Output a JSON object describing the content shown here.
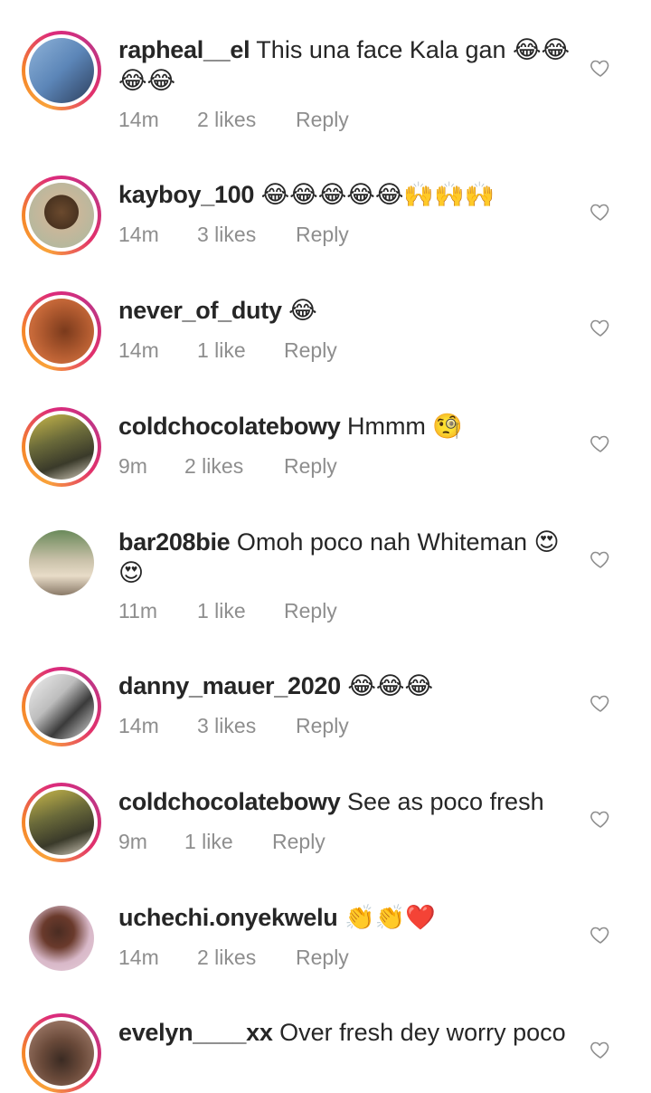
{
  "comments": [
    {
      "username": "rapheal__el",
      "text": " This una face Kala gan 😂😂😂😂",
      "time": "14m",
      "likes": "2 likes",
      "reply": "Reply"
    },
    {
      "username": "kayboy_100",
      "text": " 😂😂😂😂😂🙌🙌🙌",
      "time": "14m",
      "likes": "3 likes",
      "reply": "Reply"
    },
    {
      "username": "never_of_duty",
      "text": " 😂",
      "time": "14m",
      "likes": "1 like",
      "reply": "Reply"
    },
    {
      "username": "coldchocolatebowy",
      "text": " Hmmm 🧐",
      "time": "9m",
      "likes": "2 likes",
      "reply": "Reply"
    },
    {
      "username": "bar208bie",
      "text": " Omoh poco nah Whiteman 😍😍",
      "time": "11m",
      "likes": "1 like",
      "reply": "Reply"
    },
    {
      "username": "danny_mauer_2020",
      "text": " 😂😂😂",
      "time": "14m",
      "likes": "3 likes",
      "reply": "Reply"
    },
    {
      "username": "coldchocolatebowy",
      "text": " See as poco fresh",
      "time": "9m",
      "likes": "1 like",
      "reply": "Reply"
    },
    {
      "username": "uchechi.onyekwelu",
      "text": " 👏👏❤️",
      "time": "14m",
      "likes": "2 likes",
      "reply": "Reply"
    },
    {
      "username": "evelyn____xx",
      "text": " Over fresh dey worry poco"
    }
  ],
  "icons": {
    "like": "heart-outline-icon",
    "story_ring": [
      "#f9a23a",
      "#dd2a7b",
      "#c13584"
    ]
  }
}
